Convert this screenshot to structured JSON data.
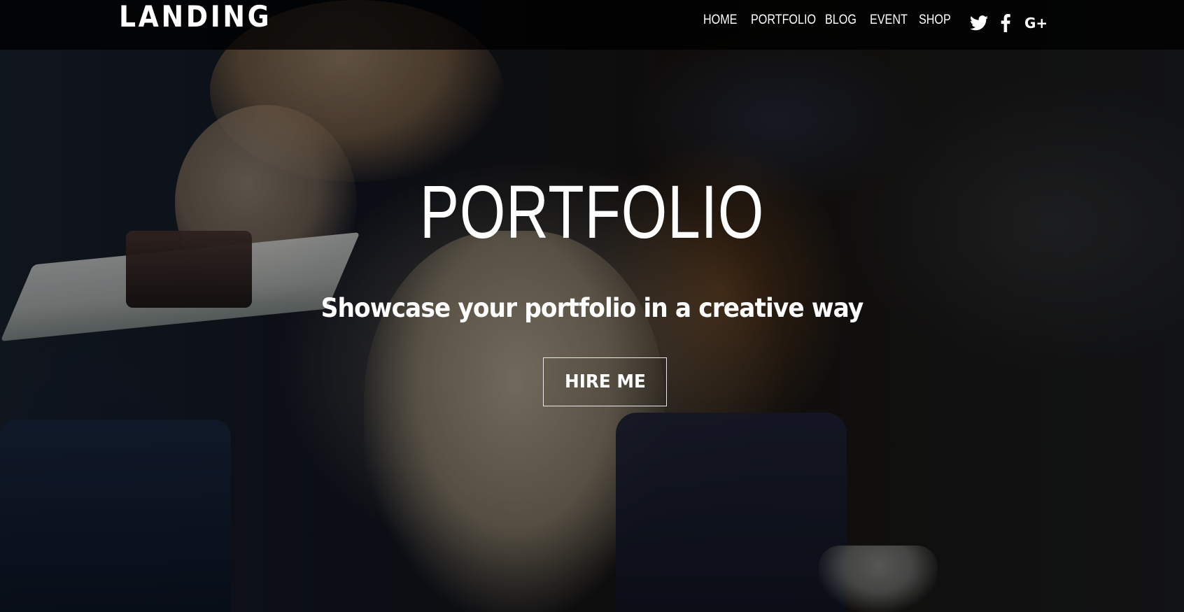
{
  "header": {
    "brand": "LANDING",
    "nav": [
      {
        "label": "HOME"
      },
      {
        "label": "PORTFOLIO"
      },
      {
        "label": "BLOG"
      },
      {
        "label": "EVENT"
      },
      {
        "label": "SHOP"
      }
    ],
    "social": [
      {
        "icon": "twitter-icon"
      },
      {
        "icon": "facebook-icon"
      },
      {
        "icon": "google-plus-icon",
        "glyph": "G+"
      }
    ]
  },
  "hero": {
    "title": "PORTFOLIO",
    "subtitle": "Showcase your portfolio in a creative way",
    "cta_label": "HIRE ME",
    "background": "photo of a woman eating cake in a lounge"
  },
  "colors": {
    "text": "#ffffff",
    "topbar_bg": "#000000",
    "button_border": "#e8e8e8"
  }
}
